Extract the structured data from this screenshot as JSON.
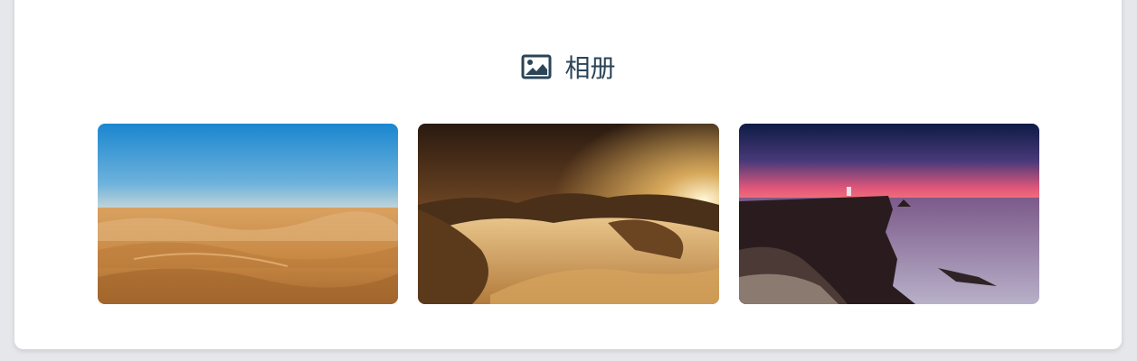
{
  "album": {
    "title": "相册",
    "title_icon": "image-icon",
    "title_color": "#2b4457",
    "photos": [
      {
        "icon": "desert-dunes-photo"
      },
      {
        "icon": "sunset-dunes-photo"
      },
      {
        "icon": "coastal-cliff-photo"
      }
    ]
  }
}
